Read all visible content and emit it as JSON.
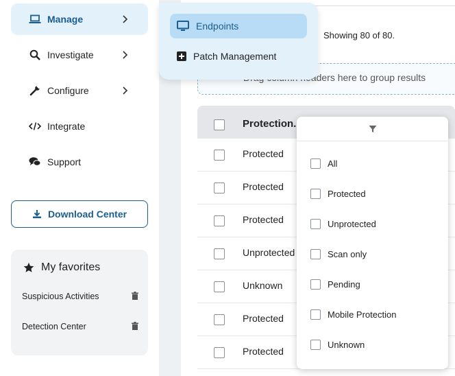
{
  "sidebar": {
    "nav": [
      {
        "label": "Manage",
        "icon": "laptop-icon",
        "active": true
      },
      {
        "label": "Investigate",
        "icon": "search-icon"
      },
      {
        "label": "Configure",
        "icon": "wrench-icon"
      },
      {
        "label": "Integrate",
        "icon": "code-icon"
      },
      {
        "label": "Support",
        "icon": "chat-icon"
      }
    ],
    "download_label": "Download Center",
    "favorites": {
      "title": "My favorites",
      "items": [
        "Suspicious Activities",
        "Detection Center"
      ]
    }
  },
  "manage_menu": {
    "items": [
      {
        "label": "Endpoints",
        "icon": "monitor-icon",
        "active": true
      },
      {
        "label": "Patch Management",
        "icon": "plus-square-icon"
      }
    ]
  },
  "grid": {
    "showing_text": "Showing 80 of 80.",
    "group_hint": "Drag column headers here to group results",
    "column_header": "Protection...",
    "rows": [
      "Protected",
      "Protected",
      "Protected",
      "Unprotected",
      "Unknown",
      "Protected",
      "Protected"
    ]
  },
  "filter": {
    "options": [
      "All",
      "Protected",
      "Unprotected",
      "Scan only",
      "Pending",
      "Mobile Protection",
      "Unknown"
    ]
  },
  "colors": {
    "accent": "#1b5d8f",
    "active_bg": "#e3f1fb",
    "active_item_bg": "#b8dcf5",
    "header_bg": "#e4e6e9"
  }
}
